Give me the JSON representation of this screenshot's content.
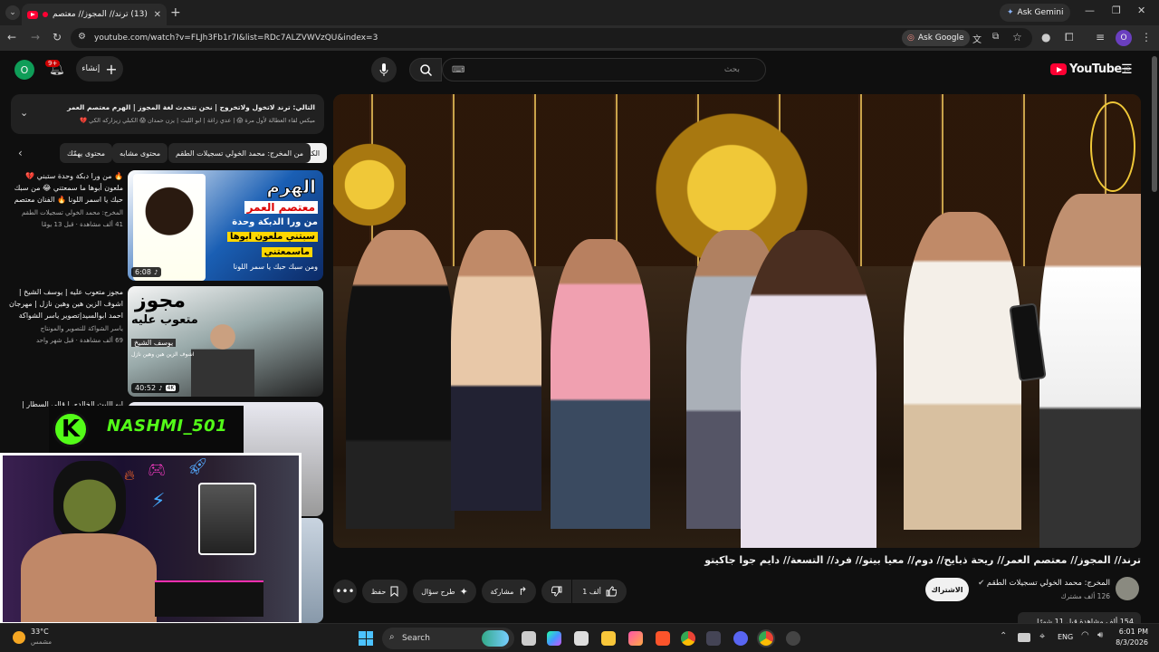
{
  "browser": {
    "tab_title": "(13) ترند// المجوز// معتصم",
    "url": "youtube.com/watch?v=FLJh3Fb1r7I&list=RDc7ALZVWVzQU&index=3",
    "ask_gemini": "Ask Gemini",
    "ask_google": "Ask Google",
    "profile_initial": "O"
  },
  "youtube": {
    "logo_text": "YouTube",
    "logo_country": "JO",
    "search_placeholder": "بحث",
    "create_label": "إنشاء",
    "notifications_count": "9+",
    "avatar_initial": "O"
  },
  "queue": {
    "next_label": "التالي:",
    "next_title": "ترند لاتخول ولاتخروج | نحن تتحدث لغة المجوز | الهرم معتصم العمر",
    "mix_line": "ميكس لقاء العطالة لأول مرة 😱 | عدي زاغة | ابو الليث | يزن حمدان 😱 الكبلي زيزاركه الكي 💔"
  },
  "chips": [
    "الكل",
    "من المخرج: محمد الخولي تسجيلات الطقم",
    "محتوى مشابه",
    "محتوى يهمّك"
  ],
  "related": [
    {
      "title": "🔥 من ورا دبكة وحدة ستبني 💔 ملعون أبوها ما سمعتني 😂 من سبك حبك يا اسمر اللونا 🔥 الفنان معتصم العمر",
      "channel": "المخرج: محمد الخولي تسجيلات الطقم",
      "meta": "41 ألف مشاهدة · قبل 13 يومًا",
      "duration": "6:08",
      "thumb_title": "الهرم",
      "thumb_sub": "معتصم العمر",
      "thumb_line1": "من ورا الدبكة وحدة",
      "thumb_line2": "سبتني ملعون ابوها",
      "thumb_line3": "ماسمعتني",
      "thumb_line4": "ومن سبك حبك يا سمر اللونا"
    },
    {
      "title": "مجوز متعوب عليه | يوسف الشيخ | اشوف الزين هين وهين نازل | مهرجان احمد ابوالسيد|تصوير ياسر الشواكة 4K",
      "channel": "ياسر الشواكة للتصوير والمونتاج",
      "meta": "69 ألف مشاهدة · قبل شهر واحد",
      "duration": "40:52",
      "badge": "4K",
      "thumb_title": "مجوز",
      "thumb_sub": "متعوب عليه",
      "thumb_line1": "يوسف الشيخ",
      "thumb_line2": "اشوف الزين هين وهين نازل"
    },
    {
      "title": "ابو الليث الخالدي | قالي السطار | الفنان باسل"
    }
  ],
  "overlay": {
    "streamer_name": "NASHMI_501",
    "logo_letter": "K"
  },
  "video": {
    "title": "ترند// المجوز// معتصم العمر// ريحة ذبايح// دوم// معيا بيتو// فرد// التسعة// دايم جوا جاكيتو",
    "channel": "المخرج: محمد الخولي تسجيلات الطقم",
    "subscribers": "126 ألف مشترك",
    "subscribe_label": "الاشتراك",
    "likes": "1 ألف",
    "share_label": "مشاركة",
    "ask_label": "طرح سؤال",
    "save_label": "حفظ",
    "description_preview": "154 ألف مشاهدة قبل 11 شهرًا"
  },
  "taskbar": {
    "weather_temp": "33°C",
    "weather_desc": "مشمس",
    "search_label": "Search",
    "language": "ENG",
    "time": "6:01 PM",
    "date": "8/3/2026"
  }
}
